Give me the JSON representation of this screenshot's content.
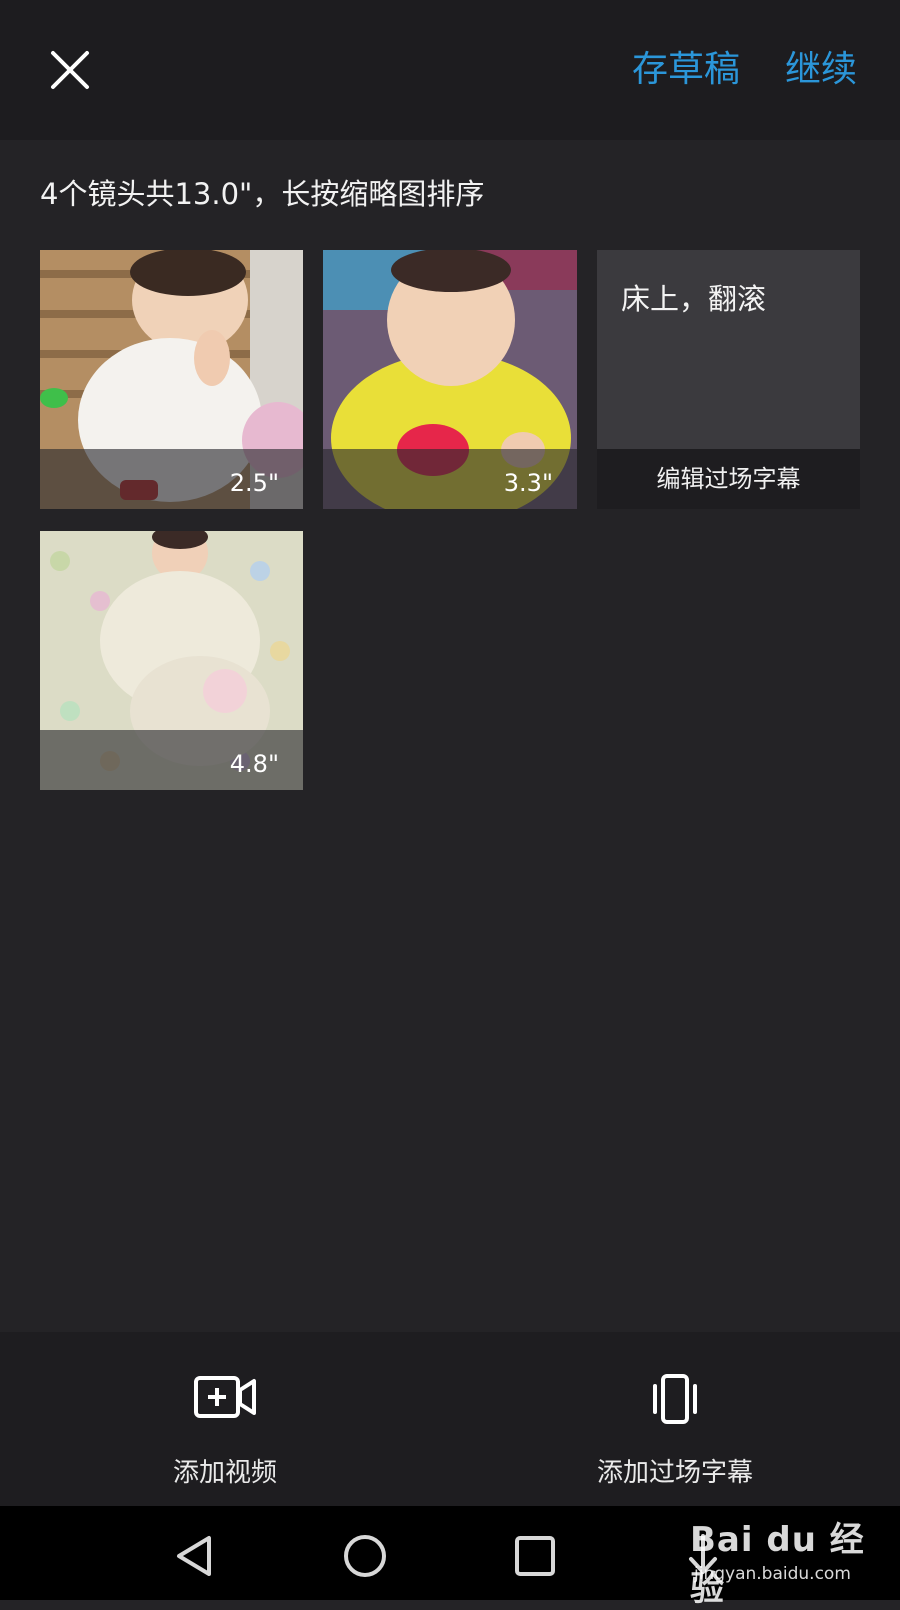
{
  "header": {
    "close_icon": "close-icon",
    "save_draft_label": "存草稿",
    "continue_label": "继续",
    "accent_color": "#2b96d9"
  },
  "summary": "4个镜头共13.0\"，长按缩略图排序",
  "clips": [
    {
      "type": "video",
      "duration": "2.5\""
    },
    {
      "type": "video",
      "duration": "3.3\""
    },
    {
      "type": "caption",
      "text": "床上，翻滚",
      "edit_label": "编辑过场字幕"
    },
    {
      "type": "video",
      "duration": "4.8\""
    }
  ],
  "bottom_bar": {
    "add_video_label": "添加视频",
    "add_video_icon": "video-camera-plus-icon",
    "add_caption_label": "添加过场字幕",
    "add_caption_icon": "phone-vibrate-icon"
  },
  "nav": {
    "back_icon": "nav-back-icon",
    "home_icon": "nav-home-icon",
    "recent_icon": "nav-recent-icon",
    "down_icon": "nav-down-icon"
  },
  "watermark": {
    "logo_text": "Bai du 经验",
    "url": "jingyan.baidu.com"
  }
}
